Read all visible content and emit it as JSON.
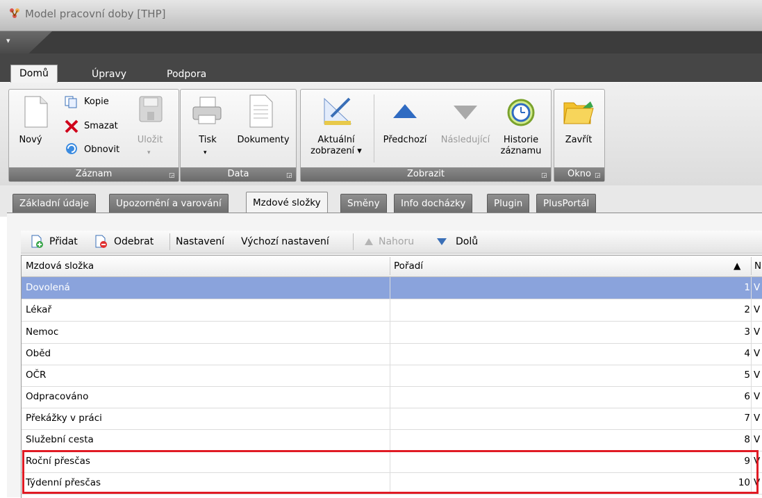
{
  "window": {
    "title": "Model pracovní doby [THP]"
  },
  "ribbon_tabs": [
    "Domů",
    "Úpravy",
    "Podpora"
  ],
  "ribbon": {
    "zaznam": {
      "label": "Záznam",
      "new": "Nový",
      "copy": "Kopie",
      "delete": "Smazat",
      "refresh": "Obnovit",
      "save": "Uložit"
    },
    "data": {
      "label": "Data",
      "print": "Tisk",
      "documents": "Dokumenty"
    },
    "zobrazit": {
      "label": "Zobrazit",
      "current_view_1": "Aktuální",
      "current_view_2": "zobrazení ▾",
      "previous": "Předchozí",
      "next": "Následující",
      "history_1": "Historie",
      "history_2": "záznamu"
    },
    "okno": {
      "label": "Okno",
      "close": "Zavřít"
    }
  },
  "doc_tabs": [
    "Základní údaje",
    "Upozornění a varování",
    "Mzdové složky",
    "Směny",
    "Info docházky",
    "Plugin",
    "PlusPortál"
  ],
  "grid_toolbar": {
    "add": "Přidat",
    "remove": "Odebrat",
    "settings": "Nastavení",
    "default_settings": "Výchozí nastavení",
    "up": "Nahoru",
    "down": "Dolů"
  },
  "grid": {
    "columns": [
      "Mzdová složka",
      "Pořadí",
      "N"
    ],
    "sort_indicator": "▲",
    "rows": [
      {
        "name": "Dovolená",
        "order": "1",
        "last": "V"
      },
      {
        "name": "Lékař",
        "order": "2",
        "last": "V"
      },
      {
        "name": "Nemoc",
        "order": "3",
        "last": "V"
      },
      {
        "name": "Oběd",
        "order": "4",
        "last": "V"
      },
      {
        "name": "OČR",
        "order": "5",
        "last": "V"
      },
      {
        "name": "Odpracováno",
        "order": "6",
        "last": "V"
      },
      {
        "name": "Překážky v práci",
        "order": "7",
        "last": "V"
      },
      {
        "name": "Služební cesta",
        "order": "8",
        "last": "V"
      },
      {
        "name": "Roční přesčas",
        "order": "9",
        "last": "V"
      },
      {
        "name": "Týdenní přesčas",
        "order": "10",
        "last": "V"
      }
    ]
  }
}
